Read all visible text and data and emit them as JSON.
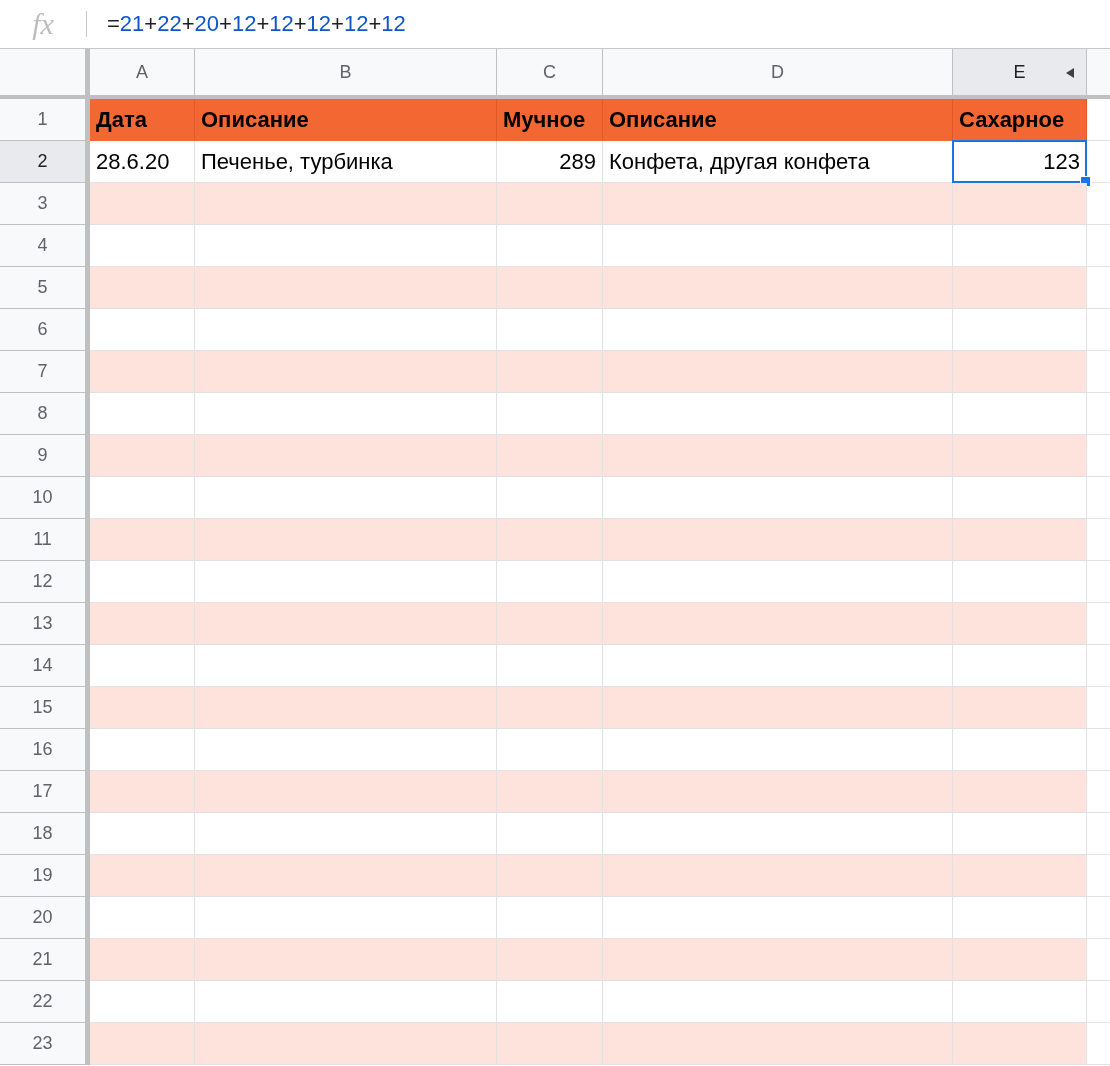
{
  "formula_bar": {
    "label": "fx",
    "tokens": [
      {
        "kind": "operator",
        "text": "="
      },
      {
        "kind": "number",
        "text": "21"
      },
      {
        "kind": "operator",
        "text": "+"
      },
      {
        "kind": "number",
        "text": "22"
      },
      {
        "kind": "operator",
        "text": "+"
      },
      {
        "kind": "number",
        "text": "20"
      },
      {
        "kind": "operator",
        "text": "+"
      },
      {
        "kind": "number",
        "text": "12"
      },
      {
        "kind": "operator",
        "text": "+"
      },
      {
        "kind": "number",
        "text": "12"
      },
      {
        "kind": "operator",
        "text": "+"
      },
      {
        "kind": "number",
        "text": "12"
      },
      {
        "kind": "operator",
        "text": "+"
      },
      {
        "kind": "number",
        "text": "12"
      },
      {
        "kind": "operator",
        "text": "+"
      },
      {
        "kind": "number",
        "text": "12"
      }
    ]
  },
  "columns": [
    {
      "label": "A",
      "selected": false
    },
    {
      "label": "B",
      "selected": false
    },
    {
      "label": "C",
      "selected": false
    },
    {
      "label": "D",
      "selected": false
    },
    {
      "label": "E",
      "selected": true
    }
  ],
  "rows": [
    {
      "number": "1",
      "kind": "header",
      "selected": false,
      "cells": [
        {
          "text": "Дата",
          "kind": "text",
          "selected": false
        },
        {
          "text": "Описание",
          "kind": "text",
          "selected": false
        },
        {
          "text": "Мучное",
          "kind": "text",
          "selected": false
        },
        {
          "text": "Описание",
          "kind": "text",
          "selected": false
        },
        {
          "text": "Сахарное",
          "kind": "text",
          "selected": false
        }
      ]
    },
    {
      "number": "2",
      "kind": "data",
      "selected": true,
      "banded": false,
      "cells": [
        {
          "text": "28.6.20",
          "kind": "text",
          "selected": false
        },
        {
          "text": "Печенье, турбинка",
          "kind": "text",
          "selected": false
        },
        {
          "text": "289",
          "kind": "number",
          "selected": false
        },
        {
          "text": "Конфета, другая конфета",
          "kind": "text",
          "selected": false
        },
        {
          "text": "123",
          "kind": "number",
          "selected": true
        }
      ]
    },
    {
      "number": "3",
      "kind": "data",
      "selected": false,
      "banded": true
    },
    {
      "number": "4",
      "kind": "data",
      "selected": false,
      "banded": false
    },
    {
      "number": "5",
      "kind": "data",
      "selected": false,
      "banded": true
    },
    {
      "number": "6",
      "kind": "data",
      "selected": false,
      "banded": false
    },
    {
      "number": "7",
      "kind": "data",
      "selected": false,
      "banded": true
    },
    {
      "number": "8",
      "kind": "data",
      "selected": false,
      "banded": false
    },
    {
      "number": "9",
      "kind": "data",
      "selected": false,
      "banded": true
    },
    {
      "number": "10",
      "kind": "data",
      "selected": false,
      "banded": false
    },
    {
      "number": "11",
      "kind": "data",
      "selected": false,
      "banded": true
    },
    {
      "number": "12",
      "kind": "data",
      "selected": false,
      "banded": false
    },
    {
      "number": "13",
      "kind": "data",
      "selected": false,
      "banded": true
    },
    {
      "number": "14",
      "kind": "data",
      "selected": false,
      "banded": false
    },
    {
      "number": "15",
      "kind": "data",
      "selected": false,
      "banded": true
    },
    {
      "number": "16",
      "kind": "data",
      "selected": false,
      "banded": false
    },
    {
      "number": "17",
      "kind": "data",
      "selected": false,
      "banded": true
    },
    {
      "number": "18",
      "kind": "data",
      "selected": false,
      "banded": false
    },
    {
      "number": "19",
      "kind": "data",
      "selected": false,
      "banded": true
    },
    {
      "number": "20",
      "kind": "data",
      "selected": false,
      "banded": false
    },
    {
      "number": "21",
      "kind": "data",
      "selected": false,
      "banded": true
    },
    {
      "number": "22",
      "kind": "data",
      "selected": false,
      "banded": false
    },
    {
      "number": "23",
      "kind": "data",
      "selected": false,
      "banded": true
    }
  ]
}
